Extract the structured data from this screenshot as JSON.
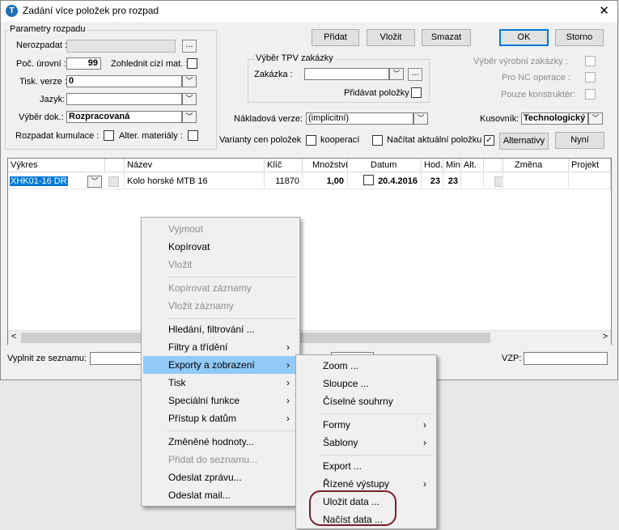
{
  "window": {
    "title": "Zadání více položek pro rozpad",
    "close": "✕",
    "icon_letter": "T"
  },
  "params": {
    "group_title": "Parametry rozpadu",
    "nerozpadat_label": "Nerozpadat :",
    "nerozpadat_value": "",
    "poc_urovni_label": "Poč. úrovní :",
    "poc_urovni_value": "99",
    "zohlednit_label": "Zohlednit cizí mat. :",
    "tisk_verze_label": "Tisk. verze :",
    "tisk_verze_value": "0",
    "jazyk_label": "Jazyk:",
    "jazyk_value": "",
    "vyber_dok_label": "Výběr dok.:",
    "vyber_dok_value": "Rozpracovaná",
    "rozpadat_label": "Rozpadat kumulace :",
    "alter_label": "Alter. materiály :"
  },
  "tpv": {
    "group_title": "Výběr TPV zakázky",
    "zakazka_label": "Zakázka :",
    "zakazka_value": "",
    "pridavat_label": "Přidávat položky"
  },
  "buttons": {
    "pridat": "Přidat",
    "vlozit": "Vložit",
    "smazat": "Smazat",
    "ok": "OK",
    "storno": "Storno",
    "alternativy": "Alternativy",
    "nyni": "Nyní",
    "ellipsis": "..."
  },
  "right_options": {
    "vyrobni_label": "Výběr výrobní zakázky :",
    "nc_label": "Pro NC operace :",
    "konstrukter_label": "Pouze konstruktér:"
  },
  "row2": {
    "nakladova_label": "Nákladová verze:",
    "nakladova_value": "(implicitní)",
    "kusovnik_label": "Kusovník:",
    "kusovnik_value": "Technologický"
  },
  "row3": {
    "varianty_label": "Varianty cen položek",
    "kooperaci_label": "kooperací",
    "nacitat_label": "Načítat aktuální položku",
    "nacitat_check": "✓"
  },
  "grid": {
    "columns": [
      "Výkres",
      "Název",
      "Klíč",
      "Množství",
      "Datum",
      "Hod.",
      "Min.",
      "Alt.",
      "Změna",
      "Projekt"
    ],
    "row": {
      "vykres": "XHK01-16 DR",
      "nazev": "Kolo horské MTB 16",
      "klic": "11870",
      "mnozstvi": "1,00",
      "datum": "20.4.2016",
      "hod": "23",
      "min": "23"
    }
  },
  "bottom": {
    "vyplnit_label": "Vyplnit ze seznamu:",
    "vzp_label": "VZP:"
  },
  "context_menu": {
    "items": [
      {
        "label": "Vyjmout"
      },
      {
        "label": "Kopírovat"
      },
      {
        "label": "Vložit"
      },
      {
        "label": "Kopírovat záznamy"
      },
      {
        "label": "Vložit záznamy"
      },
      {
        "label": "Hledání, filtrování ..."
      },
      {
        "label": "Filtry a třídění"
      },
      {
        "label": "Exporty a zobrazení"
      },
      {
        "label": "Tisk"
      },
      {
        "label": "Speciální funkce"
      },
      {
        "label": "Přístup k datům"
      },
      {
        "label": "Změněné hodnoty..."
      },
      {
        "label": "Přidat do seznamu..."
      },
      {
        "label": "Odeslat zprávu..."
      },
      {
        "label": "Odeslat mail..."
      }
    ],
    "arrow": "›"
  },
  "submenu": {
    "items": [
      {
        "label": "Zoom ..."
      },
      {
        "label": "Sloupce ..."
      },
      {
        "label": "Číselné souhrny"
      },
      {
        "label": "Formy"
      },
      {
        "label": "Šablony"
      },
      {
        "label": "Export ..."
      },
      {
        "label": "Řízené výstupy"
      },
      {
        "label": "Uložit data ..."
      },
      {
        "label": "Načíst data ..."
      }
    ]
  },
  "colors": {
    "accent": "#0078d7",
    "menu_highlight": "#91c9f7",
    "selection": "#0078d7",
    "oval": "#7a1f2c"
  }
}
